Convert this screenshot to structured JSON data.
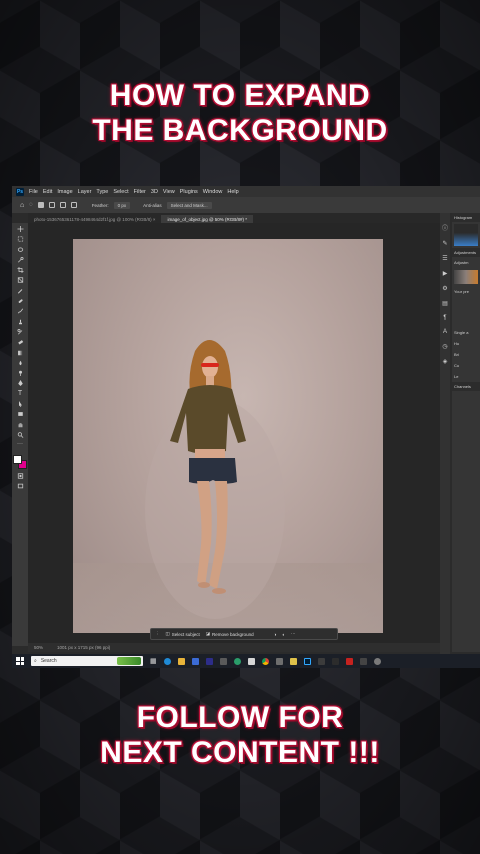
{
  "headline_top": {
    "line1": "HOW TO EXPAND",
    "line2": "THE BACKGROUND"
  },
  "headline_bottom": {
    "line1": "FOLLOW FOR",
    "line2": "NEXT CONTENT !!!"
  },
  "colors": {
    "text": "#ffffff",
    "glow": "#c0123a",
    "ps_bg": "#2b2b2b",
    "taskbar": "#1b1f27",
    "accent_pink": "#e0008c",
    "ps_blue": "#31a8ff"
  },
  "photoshop": {
    "logo": "Ps",
    "menu": [
      "File",
      "Edit",
      "Image",
      "Layer",
      "Type",
      "Select",
      "Filter",
      "3D",
      "View",
      "Plugins",
      "Window",
      "Help"
    ],
    "options": {
      "feather_label": "Feather:",
      "feather_value": "0 px",
      "anti_alias": "Anti-alias",
      "select_mask": "Select and Mask..."
    },
    "tabs": [
      {
        "label": "photo-1536765361178-4498464d2f1f.jpg @ 100% (RGB/8) ×",
        "active": false
      },
      {
        "label": "image_of_object.jpg @ 50% (RGB/8#) *",
        "active": true
      }
    ],
    "contextual_bar": {
      "select_subject": "Select subject",
      "remove_background": "Remove background"
    },
    "status": {
      "zoom": "50%",
      "doc_size": "1001 px x 1715 px (96 ppi)"
    },
    "panels": {
      "histogram": "Histogram",
      "adjustments": "Adjustments",
      "adjustments_sub": "Adjustm",
      "your_presets": "Your pre",
      "single": "Single a",
      "items": [
        "Hu",
        "Bri",
        "Cu",
        "Le"
      ],
      "channels": "Channels"
    }
  },
  "taskbar": {
    "search_placeholder": "Search"
  }
}
